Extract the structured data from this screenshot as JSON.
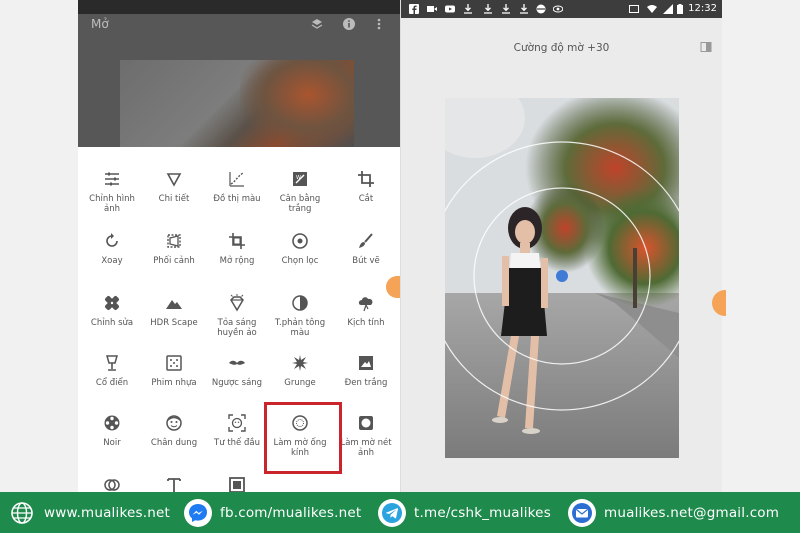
{
  "left_screen": {
    "app_title": "Mở",
    "tools": [
      {
        "label": "Chỉnh hình ảnh",
        "icon": "tune-icon"
      },
      {
        "label": "Chi tiết",
        "icon": "triangle-details-icon"
      },
      {
        "label": "Đồ thị màu",
        "icon": "curves-icon"
      },
      {
        "label": "Cân bằng trắng",
        "icon": "white-balance-icon"
      },
      {
        "label": "Cắt",
        "icon": "crop-icon"
      },
      {
        "label": "Xoay",
        "icon": "rotate-icon"
      },
      {
        "label": "Phối cảnh",
        "icon": "perspective-icon"
      },
      {
        "label": "Mở rộng",
        "icon": "expand-icon"
      },
      {
        "label": "Chọn lọc",
        "icon": "selective-icon"
      },
      {
        "label": "Bút vẽ",
        "icon": "brush-icon"
      },
      {
        "label": "Chỉnh sửa",
        "icon": "healing-icon"
      },
      {
        "label": "HDR Scape",
        "icon": "mountain-icon"
      },
      {
        "label": "Tỏa sáng huyền ảo",
        "icon": "glamour-glow-icon"
      },
      {
        "label": "T.phản tông màu",
        "icon": "tonal-contrast-icon"
      },
      {
        "label": "Kịch tính",
        "icon": "drama-icon"
      },
      {
        "label": "Cổ điển",
        "icon": "vintage-lamp-icon"
      },
      {
        "label": "Phim nhựa",
        "icon": "grainy-film-icon"
      },
      {
        "label": "Ngược sáng",
        "icon": "retrolux-mustache-icon"
      },
      {
        "label": "Grunge",
        "icon": "grunge-icon"
      },
      {
        "label": "Đen trắng",
        "icon": "black-white-icon"
      },
      {
        "label": "Noir",
        "icon": "film-reel-icon"
      },
      {
        "label": "Chân dung",
        "icon": "face-icon"
      },
      {
        "label": "Tư thế đầu",
        "icon": "head-pose-icon"
      },
      {
        "label": "Làm mờ ống kính",
        "icon": "lens-blur-icon"
      },
      {
        "label": "Làm mờ nét ảnh",
        "icon": "vignette-icon"
      },
      {
        "label": "",
        "icon": "double-exposure-icon"
      },
      {
        "label": "",
        "icon": "text-icon"
      },
      {
        "label": "",
        "icon": "frames-icon"
      }
    ],
    "highlighted_tool": "Làm mờ ống kính",
    "highlight_color": "#c9252b"
  },
  "right_screen": {
    "status_time": "12:32",
    "blur_strength_label": "Cường độ mờ +30",
    "blur_strength_value": 30
  },
  "footer": {
    "background": "#1e8a4c",
    "items": [
      {
        "text": "www.mualikes.net",
        "icon": "globe-icon"
      },
      {
        "text": "fb.com/mualikes.net",
        "icon": "messenger-icon"
      },
      {
        "text": "t.me/cshk_mualikes",
        "icon": "telegram-icon"
      },
      {
        "text": "mualikes.net@gmail.com",
        "icon": "email-icon"
      }
    ]
  }
}
